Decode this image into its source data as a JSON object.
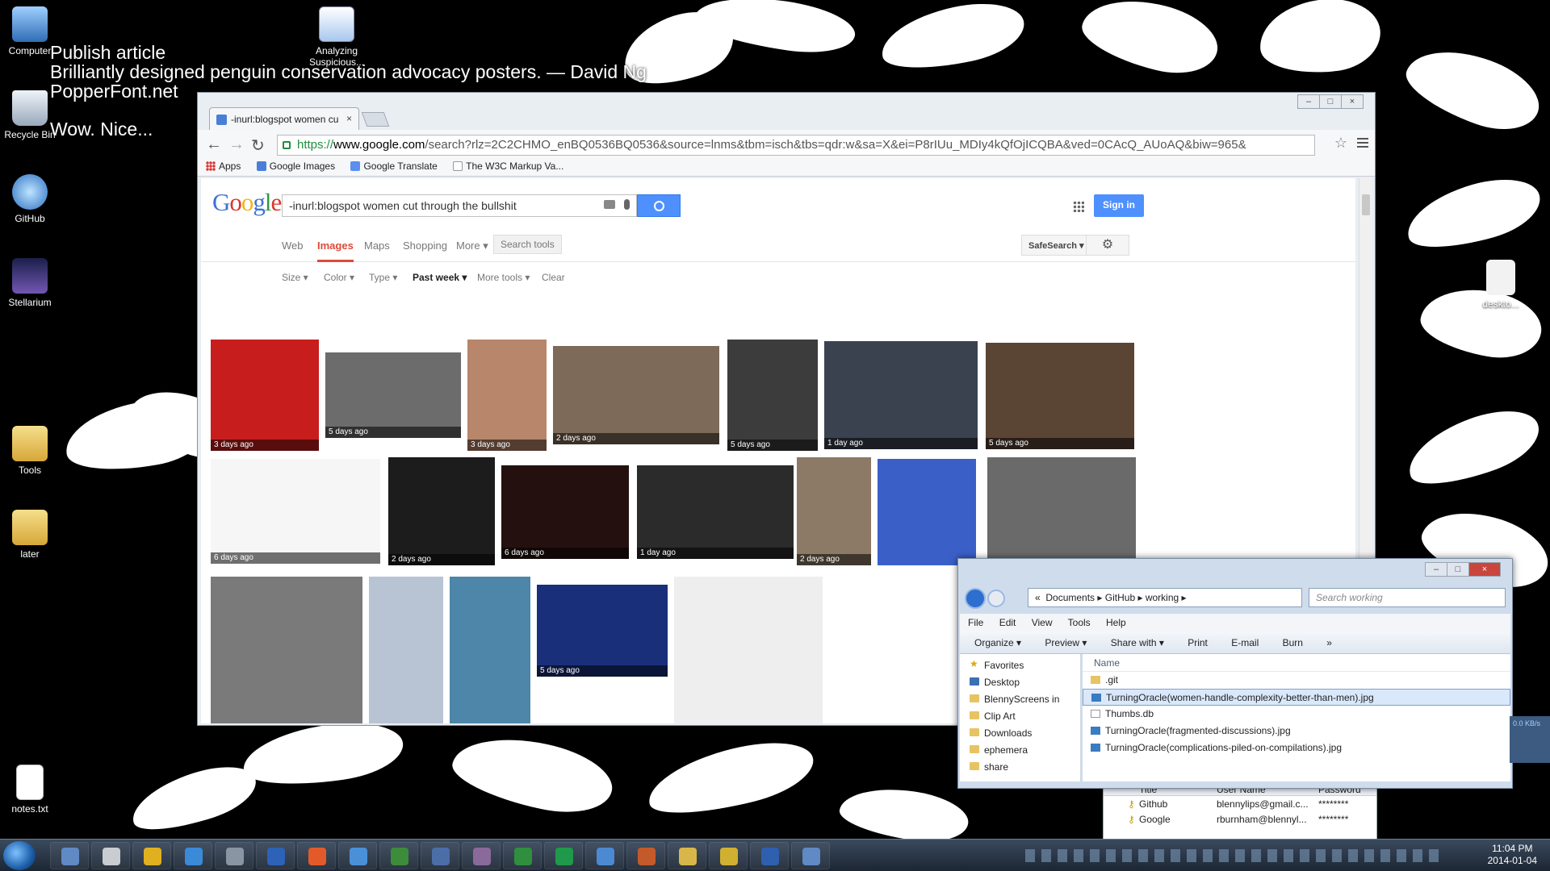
{
  "desktop": {
    "icons": [
      {
        "label": "Computer"
      },
      {
        "label": "Analyzing Suspicious..."
      },
      {
        "label": "Recycle Bin"
      },
      {
        "label": "GitHub"
      },
      {
        "label": "Stellarium"
      },
      {
        "label": "Tools"
      },
      {
        "label": "later"
      },
      {
        "label": "notes.txt"
      },
      {
        "label": "deskto..."
      }
    ],
    "overlay_lines": [
      "Publish article",
      "Brilliantly designed penguin conservation advocacy posters. — David Ng",
      "PopperFont.net",
      "Wow. Nice..."
    ]
  },
  "chrome": {
    "tab_title": "-inurl:blogspot women cu",
    "url_scheme": "https://",
    "url_host": "www.google.com",
    "url_rest": "/search?rlz=2C2CHMO_enBQ0536BQ0536&source=lnms&tbm=isch&tbs=qdr:w&sa=X&ei=P8rIUu_MDIy4kQfOjICQBA&ved=0CAcQ_AUoAQ&biw=965&",
    "bookmarks": [
      "Apps",
      "Google Images",
      "Google Translate",
      "The W3C Markup Va..."
    ]
  },
  "google": {
    "logo": "Google",
    "query": "-inurl:blogspot women cut through the bullshit",
    "sign_in": "Sign in",
    "nav": [
      "Web",
      "Images",
      "Maps",
      "Shopping",
      "More ▾"
    ],
    "search_tools": "Search tools",
    "safesearch": "SafeSearch ▾",
    "filters": [
      "Size ▾",
      "Color ▾",
      "Type ▾",
      "Past week ▾",
      "More tools ▾",
      "Clear"
    ],
    "results": [
      {
        "age": "3 days ago",
        "color": "#c81d1d"
      },
      {
        "age": "5 days ago",
        "color": "#6c6c6c"
      },
      {
        "age": "3 days ago",
        "color": "#b8866a"
      },
      {
        "age": "2 days ago",
        "color": "#7e6a58"
      },
      {
        "age": "5 days ago",
        "color": "#3c3c3c"
      },
      {
        "age": "1 day ago",
        "color": "#3a4250"
      },
      {
        "age": "5 days ago",
        "color": "#5a4434"
      },
      {
        "age": "6 days ago",
        "color": "#f6f6f6"
      },
      {
        "age": "2 days ago",
        "color": "#1c1c1c"
      },
      {
        "age": "6 days ago",
        "color": "#251010"
      },
      {
        "age": "1 day ago",
        "color": "#2b2b2b"
      },
      {
        "age": "2 days ago",
        "color": "#8c7a66"
      },
      {
        "age": "",
        "color": "#3a60c8"
      },
      {
        "age": "",
        "color": "#6a6a6a"
      },
      {
        "age": "",
        "color": "#7a7a7a"
      },
      {
        "age": "",
        "color": "#b8c4d4"
      },
      {
        "age": "",
        "color": "#4d86a8"
      },
      {
        "age": "5 days ago",
        "color": "#1a2f7a"
      },
      {
        "age": "",
        "color": "#eeeeee"
      }
    ]
  },
  "explorer": {
    "breadcrumb": [
      "«",
      "Documents",
      "GitHub",
      "working"
    ],
    "search_placeholder": "Search working",
    "menu": [
      "File",
      "Edit",
      "View",
      "Tools",
      "Help"
    ],
    "toolbar": [
      "Organize ▾",
      "Preview ▾",
      "Share with ▾",
      "Print",
      "E-mail",
      "Burn",
      "»"
    ],
    "nav_items": [
      "Favorites",
      "Desktop",
      "BlennyScreens in",
      "Clip Art",
      "Downloads",
      "ephemera",
      "share"
    ],
    "column_name": "Name",
    "files": [
      ".git",
      "TurningOracle(women-handle-complexity-better-than-men).jpg",
      "Thumbs.db",
      "TurningOracle(fragmented-discussions).jpg",
      "TurningOracle(complications-piled-on-compilations).jpg"
    ],
    "selected_index": 1
  },
  "password_manager": {
    "columns": [
      "Title",
      "User Name",
      "Password"
    ],
    "rows": [
      {
        "title": "Github",
        "user": "blennylips@gmail.c...",
        "password": "********"
      },
      {
        "title": "Google",
        "user": "rburnham@blennyl...",
        "password": "********"
      }
    ]
  },
  "net_widget": {
    "rate": "0.0 KB/s"
  },
  "taskbar": {
    "time": "11:04 PM",
    "date": "2014-01-04"
  },
  "colors": {
    "google_blue": "#4d90fe",
    "images_red": "#dd4b39",
    "url_green": "#1e8e3e"
  }
}
